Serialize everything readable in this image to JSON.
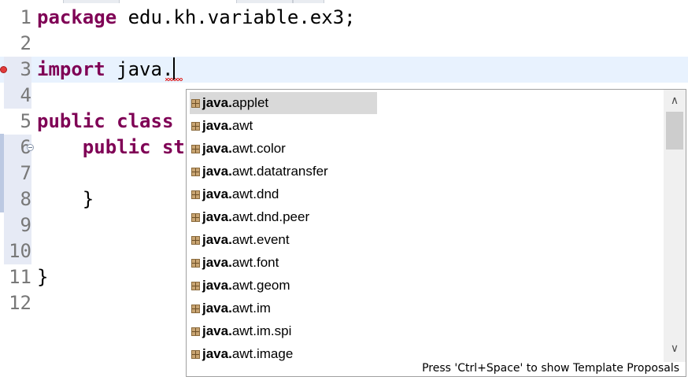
{
  "editor": {
    "lines": [
      {
        "num": "1",
        "parts": [
          {
            "t": "package",
            "kw": true
          },
          {
            "t": " edu.kh.variable.ex3;",
            "kw": false
          }
        ]
      },
      {
        "num": "2",
        "parts": []
      },
      {
        "num": "3",
        "parts": [
          {
            "t": "import",
            "kw": true
          },
          {
            "t": " java.",
            "kw": false
          }
        ]
      },
      {
        "num": "4",
        "parts": []
      },
      {
        "num": "5",
        "parts": [
          {
            "t": "public",
            "kw": true
          },
          {
            "t": " ",
            "kw": false
          },
          {
            "t": "class",
            "kw": true
          },
          {
            "t": " ",
            "kw": false
          }
        ]
      },
      {
        "num": "6",
        "parts": [
          {
            "t": "    ",
            "kw": false
          },
          {
            "t": "public",
            "kw": true
          },
          {
            "t": " ",
            "kw": false
          },
          {
            "t": "st",
            "kw": true
          }
        ]
      },
      {
        "num": "7",
        "parts": []
      },
      {
        "num": "8",
        "parts": [
          {
            "t": "    }",
            "kw": false
          }
        ]
      },
      {
        "num": "9",
        "parts": []
      },
      {
        "num": "10",
        "parts": []
      },
      {
        "num": "11",
        "parts": [
          {
            "t": "}",
            "kw": false
          }
        ]
      },
      {
        "num": "12",
        "parts": []
      }
    ],
    "current_line": "3",
    "error_line": "3",
    "fold_line": "6"
  },
  "content_assist": {
    "match_prefix": "java.",
    "proposals": [
      {
        "match": "java.",
        "rest": "applet",
        "selected": true
      },
      {
        "match": "java.",
        "rest": "awt",
        "selected": false
      },
      {
        "match": "java.",
        "rest": "awt.color",
        "selected": false
      },
      {
        "match": "java.",
        "rest": "awt.datatransfer",
        "selected": false
      },
      {
        "match": "java.",
        "rest": "awt.dnd",
        "selected": false
      },
      {
        "match": "java.",
        "rest": "awt.dnd.peer",
        "selected": false
      },
      {
        "match": "java.",
        "rest": "awt.event",
        "selected": false
      },
      {
        "match": "java.",
        "rest": "awt.font",
        "selected": false
      },
      {
        "match": "java.",
        "rest": "awt.geom",
        "selected": false
      },
      {
        "match": "java.",
        "rest": "awt.im",
        "selected": false
      },
      {
        "match": "java.",
        "rest": "awt.im.spi",
        "selected": false
      },
      {
        "match": "java.",
        "rest": "awt.image",
        "selected": false
      }
    ],
    "status_text": "Press 'Ctrl+Space' to show Template Proposals",
    "icon": "package-icon",
    "scroll_up_glyph": "∧",
    "scroll_down_glyph": "∨"
  },
  "colors": {
    "keyword": "#7f0055",
    "current_line_bg": "#e8f2fe",
    "selection_bg": "#d9d9d9",
    "line_number": "#787878"
  }
}
